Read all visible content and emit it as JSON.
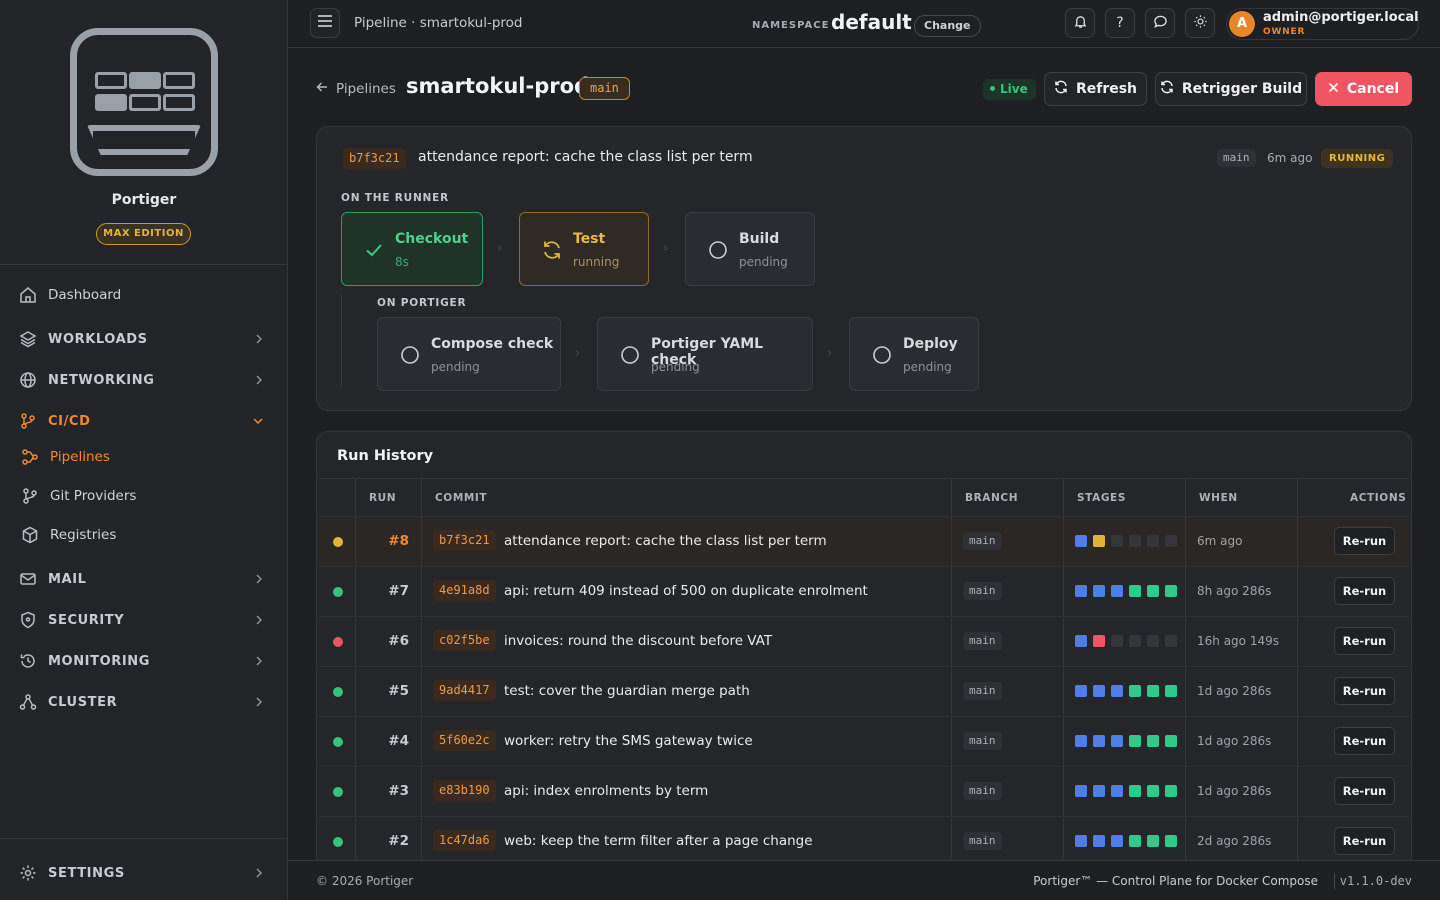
{
  "sidebar": {
    "brand_name": "Portiger",
    "edition": "MAX EDITION",
    "nav": {
      "dashboard": "Dashboard",
      "workloads": "WORKLOADS",
      "networking": "NETWORKING",
      "cicd": "CI/CD",
      "pipelines": "Pipelines",
      "git_providers": "Git Providers",
      "registries": "Registries",
      "mail": "MAIL",
      "security": "SECURITY",
      "monitoring": "MONITORING",
      "cluster": "CLUSTER",
      "settings": "SETTINGS"
    }
  },
  "topbar": {
    "breadcrumb": "Pipeline · smartokul-prod",
    "namespace_label": "NAMESPACE",
    "namespace_value": "default",
    "change_label": "Change",
    "user_initial": "A",
    "user_email": "admin@portiger.local",
    "user_role": "OWNER"
  },
  "header": {
    "back_label": "Pipelines",
    "title": "smartokul-prod",
    "branch": "main",
    "live_label": "Live",
    "refresh_label": "Refresh",
    "retrigger_label": "Retrigger Build",
    "cancel_label": "Cancel"
  },
  "current_run": {
    "sha": "b7f3c21",
    "message": "attendance report: cache the class list per term",
    "branch": "main",
    "when": "6m ago",
    "status": "RUNNING",
    "runner_label": "ON THE RUNNER",
    "portiger_label": "ON PORTIGER",
    "runner_stages": [
      {
        "name": "Checkout",
        "state": "8s"
      },
      {
        "name": "Test",
        "state": "running"
      },
      {
        "name": "Build",
        "state": "pending"
      }
    ],
    "portiger_stages": [
      {
        "name": "Compose check",
        "state": "pending"
      },
      {
        "name": "Portiger YAML check",
        "state": "pending"
      },
      {
        "name": "Deploy",
        "state": "pending"
      }
    ]
  },
  "run_history": {
    "title": "Run History",
    "columns": [
      "RUN",
      "COMMIT",
      "BRANCH",
      "STAGES",
      "WHEN",
      "ACTIONS"
    ],
    "rerun_label": "Re-run",
    "rows": [
      {
        "run": "#8",
        "sha": "b7f3c21",
        "message": "attendance report: cache the class list per term",
        "branch": "main",
        "when": "6m ago",
        "status": "running"
      },
      {
        "run": "#7",
        "sha": "4e91a8d",
        "message": "api: return 409 instead of 500 on duplicate enrolment",
        "branch": "main",
        "when": "8h ago  286s",
        "status": "success"
      },
      {
        "run": "#6",
        "sha": "c02f5be",
        "message": "invoices: round the discount before VAT",
        "branch": "main",
        "when": "16h ago  149s",
        "status": "failed"
      },
      {
        "run": "#5",
        "sha": "9ad4417",
        "message": "test: cover the guardian merge path",
        "branch": "main",
        "when": "1d ago  286s",
        "status": "success"
      },
      {
        "run": "#4",
        "sha": "5f60e2c",
        "message": "worker: retry the SMS gateway twice",
        "branch": "main",
        "when": "1d ago  286s",
        "status": "success"
      },
      {
        "run": "#3",
        "sha": "e83b190",
        "message": "api: index enrolments by term",
        "branch": "main",
        "when": "1d ago  286s",
        "status": "success"
      },
      {
        "run": "#2",
        "sha": "1c47da6",
        "message": "web: keep the term filter after a page change",
        "branch": "main",
        "when": "2d ago  286s",
        "status": "success"
      }
    ]
  },
  "footer": {
    "copyright": "© 2026 Portiger",
    "tagline": "Portiger™ — Control Plane for Docker Compose",
    "version": "v1.1.0-dev"
  },
  "colors": {
    "accent": "#f08a2c",
    "success": "#39c27a",
    "running": "#e2b33a",
    "failed": "#ef5661",
    "stage_blue": "#4f7fe6",
    "stage_green": "#2fc98a"
  }
}
